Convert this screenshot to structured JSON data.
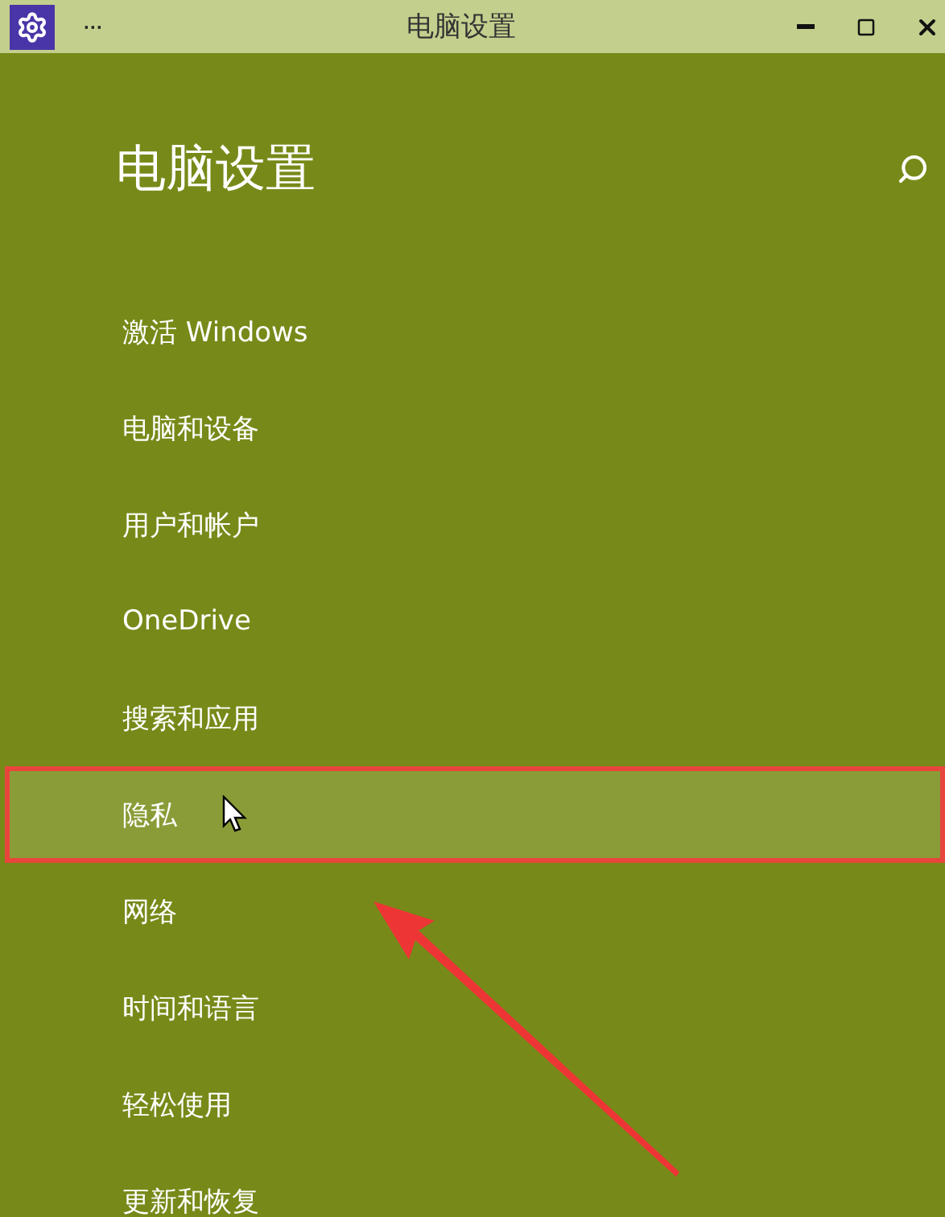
{
  "window": {
    "title": "电脑设置",
    "menu": "···"
  },
  "heading": "电脑设置",
  "items": [
    {
      "label": "激活 Windows",
      "selected": false
    },
    {
      "label": "电脑和设备",
      "selected": false
    },
    {
      "label": "用户和帐户",
      "selected": false
    },
    {
      "label": "OneDrive",
      "selected": false
    },
    {
      "label": "搜索和应用",
      "selected": false
    },
    {
      "label": "隐私",
      "selected": true
    },
    {
      "label": "网络",
      "selected": false
    },
    {
      "label": "时间和语言",
      "selected": false
    },
    {
      "label": "轻松使用",
      "selected": false
    },
    {
      "label": "更新和恢复",
      "selected": false
    }
  ]
}
